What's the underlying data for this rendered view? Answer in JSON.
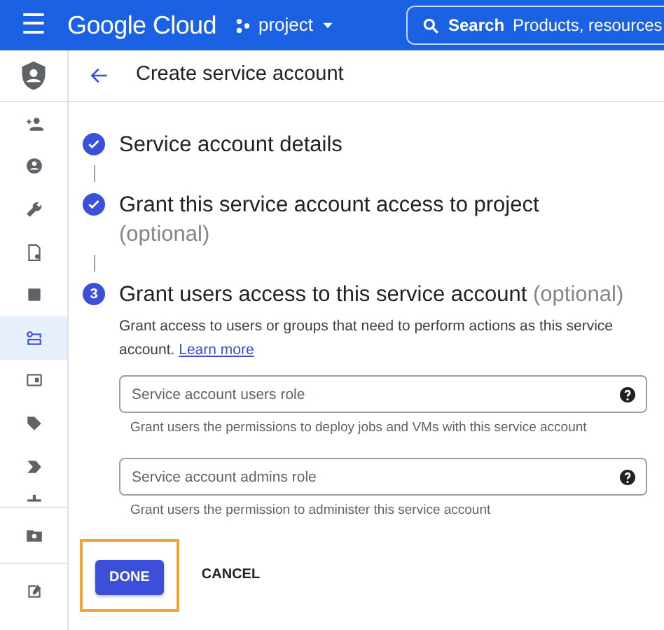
{
  "header": {
    "menu_glyph": "☰",
    "brand": "Google Cloud",
    "project": "project",
    "search": {
      "label": "Search",
      "placeholder": "Products, resources"
    }
  },
  "sidebar": {
    "items": [
      {
        "selected": false
      },
      {
        "selected": false
      },
      {
        "selected": false
      },
      {
        "selected": false
      },
      {
        "selected": false
      },
      {
        "selected": true
      },
      {
        "selected": false
      },
      {
        "selected": false
      },
      {
        "selected": false
      },
      {
        "selected": false
      },
      {
        "selected": false
      },
      {
        "selected": false
      }
    ]
  },
  "page": {
    "title": "Create service account"
  },
  "steps": [
    {
      "kind": "done",
      "title": "Service account details"
    },
    {
      "kind": "done",
      "title": "Grant this service account access to project",
      "optional": "(optional)"
    },
    {
      "kind": "current",
      "number": "3",
      "title": "Grant users access to this service account",
      "optional": "(optional)",
      "description": "Grant access to users or groups that need to perform actions as this service account.",
      "link": "Learn more"
    }
  ],
  "fields": [
    {
      "placeholder": "Service account users role",
      "hint": "Grant users the permissions to deploy jobs and VMs with this service account"
    },
    {
      "placeholder": "Service account admins role",
      "hint": "Grant users the permission to administer this service account"
    }
  ],
  "buttons": [
    {
      "label": "DONE",
      "kind": "primary",
      "highlighted": true
    },
    {
      "label": "CANCEL",
      "kind": "text",
      "highlighted": false
    }
  ]
}
